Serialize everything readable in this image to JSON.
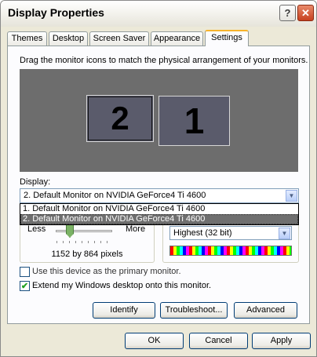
{
  "window": {
    "title": "Display Properties",
    "help_glyph": "?",
    "close_glyph": "✕"
  },
  "tabs": [
    {
      "label": "Themes"
    },
    {
      "label": "Desktop"
    },
    {
      "label": "Screen Saver"
    },
    {
      "label": "Appearance"
    },
    {
      "label": "Settings"
    }
  ],
  "settings": {
    "instruction": "Drag the monitor icons to match the physical arrangement of your monitors.",
    "monitors": [
      {
        "label": "2"
      },
      {
        "label": "1"
      }
    ],
    "display_label": "Display:",
    "display_selected": "2. Default Monitor on NVIDIA GeForce4 Ti 4600",
    "display_options": [
      "1. Default Monitor on NVIDIA GeForce4 Ti 4600",
      "2. Default Monitor on NVIDIA GeForce4 Ti 4600"
    ],
    "resolution": {
      "less": "Less",
      "more": "More",
      "value": "1152 by 864 pixels"
    },
    "color_quality": {
      "selected": "Highest (32 bit)"
    },
    "primary_checkbox": {
      "label": "Use this device as the primary monitor.",
      "checked": false
    },
    "extend_checkbox": {
      "label": "Extend my Windows desktop onto this monitor.",
      "checked": true
    },
    "buttons": {
      "identify": "Identify",
      "troubleshoot": "Troubleshoot...",
      "advanced": "Advanced"
    }
  },
  "footer": {
    "ok": "OK",
    "cancel": "Cancel",
    "apply": "Apply"
  },
  "colors": {
    "accent_tab": "#f7b32b",
    "monitor_area": "#6d6d6d",
    "selection": "#6f6f6f"
  }
}
